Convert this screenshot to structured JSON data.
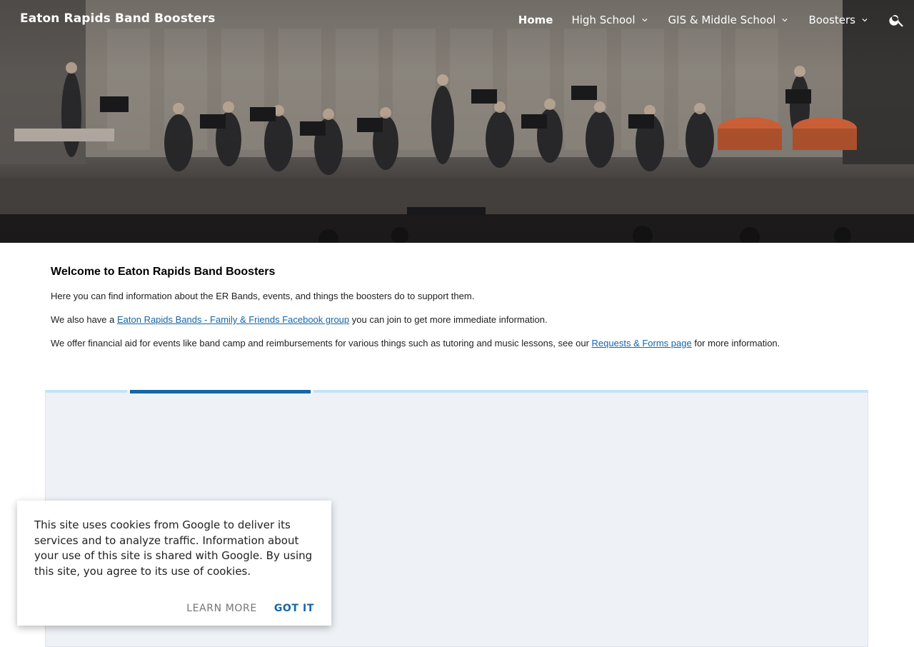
{
  "header": {
    "site_title": "Eaton Rapids Band Boosters",
    "nav": [
      {
        "label": "Home",
        "active": true,
        "has_dropdown": false
      },
      {
        "label": "High School",
        "active": false,
        "has_dropdown": true
      },
      {
        "label": "GIS & Middle School",
        "active": false,
        "has_dropdown": true
      },
      {
        "label": "Boosters",
        "active": false,
        "has_dropdown": true
      }
    ],
    "search_icon": "search-icon"
  },
  "main": {
    "heading": "Welcome to Eaton Rapids Band Boosters",
    "intro": "Here you can find information about the ER Bands, events, and things the boosters do to support them.",
    "facebook": {
      "before": "We also have a ",
      "link": "Eaton Rapids Bands - Family & Friends Facebook group",
      "after": " you can join to get more immediate information."
    },
    "aid": {
      "before": "We offer financial aid for events like band camp and reimbursements for various things such as tutoring and music lessons, see our ",
      "link": "Requests & Forms page",
      "after": " for more information."
    }
  },
  "cookie_notice": {
    "text": "This site uses cookies from Google to deliver its services and to analyze traffic. Information about your use of this site is shared with Google. By using this site, you agree to its use of cookies.",
    "learn_more": "LEARN MORE",
    "got_it": "GOT IT"
  },
  "colors": {
    "link": "#1565a8",
    "accent": "#1565a8",
    "embed_bg": "#eef2f7",
    "embed_tab_light": "#c7e2f3"
  }
}
